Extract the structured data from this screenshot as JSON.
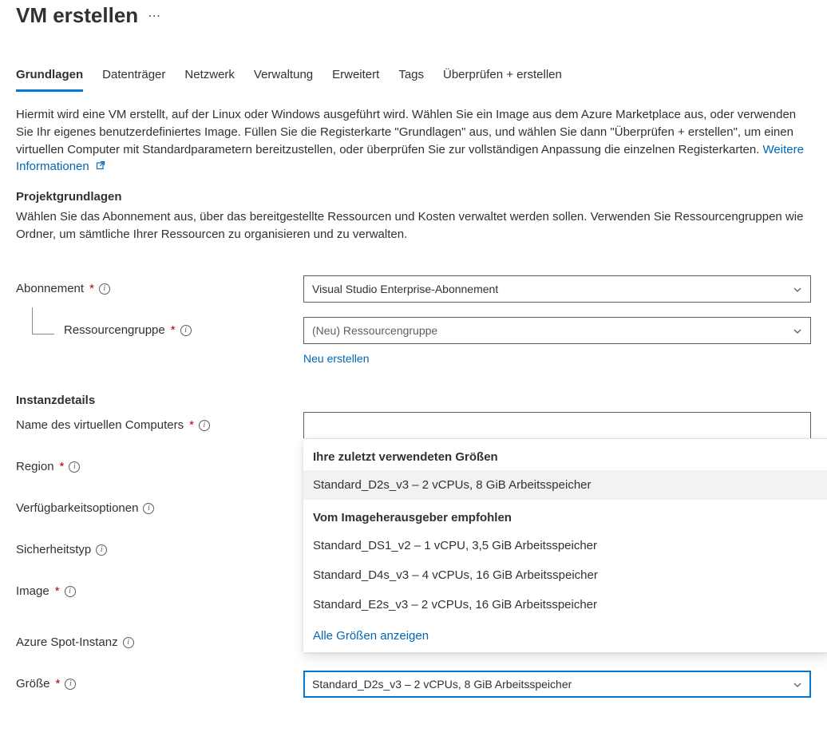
{
  "header": {
    "title": "VM erstellen"
  },
  "tabs": {
    "items": [
      {
        "label": "Grundlagen",
        "active": true
      },
      {
        "label": "Datenträger",
        "active": false
      },
      {
        "label": "Netzwerk",
        "active": false
      },
      {
        "label": "Verwaltung",
        "active": false
      },
      {
        "label": "Erweitert",
        "active": false
      },
      {
        "label": "Tags",
        "active": false
      },
      {
        "label": "Überprüfen + erstellen",
        "active": false
      }
    ]
  },
  "intro": {
    "text": "Hiermit wird eine VM erstellt, auf der Linux oder Windows ausgeführt wird. Wählen Sie ein Image aus dem Azure Marketplace aus, oder verwenden Sie Ihr eigenes benutzerdefiniertes Image. Füllen Sie die Registerkarte \"Grundlagen\" aus, und wählen Sie dann \"Überprüfen + erstellen\", um einen virtuellen Computer mit Standardparametern bereitzustellen, oder überprüfen Sie zur vollständigen Anpassung die einzelnen Registerkarten. ",
    "more_link": "Weitere Informationen"
  },
  "sections": {
    "project": {
      "heading": "Projektgrundlagen",
      "desc": "Wählen Sie das Abonnement aus, über das bereitgestellte Ressourcen und Kosten verwaltet werden sollen. Verwenden Sie Ressourcengruppen wie Ordner, um sämtliche Ihrer Ressourcen zu organisieren und zu verwalten."
    },
    "instance": {
      "heading": "Instanzdetails"
    }
  },
  "fields": {
    "subscription": {
      "label": "Abonnement",
      "value": "Visual Studio Enterprise-Abonnement"
    },
    "resource_group": {
      "label": "Ressourcengruppe",
      "value": "(Neu) Ressourcengruppe",
      "create_link": "Neu erstellen"
    },
    "vm_name": {
      "label": "Name des virtuellen Computers",
      "value": ""
    },
    "region": {
      "label": "Region"
    },
    "availability": {
      "label": "Verfügbarkeitsoptionen"
    },
    "security": {
      "label": "Sicherheitstyp"
    },
    "image": {
      "label": "Image"
    },
    "spot": {
      "label": "Azure Spot-Instanz"
    },
    "size": {
      "label": "Größe",
      "value": "Standard_D2s_v3 – 2 vCPUs, 8 GiB Arbeitsspeicher"
    }
  },
  "size_popup": {
    "group1_header": "Ihre zuletzt verwendeten Größen",
    "group1_items": [
      "Standard_D2s_v3 – 2 vCPUs, 8 GiB Arbeitsspeicher"
    ],
    "group2_header": "Vom Imageherausgeber empfohlen",
    "group2_items": [
      "Standard_DS1_v2 – 1 vCPU, 3,5 GiB Arbeitsspeicher",
      "Standard_D4s_v3 – 4 vCPUs, 16 GiB Arbeitsspeicher",
      "Standard_E2s_v3 – 2 vCPUs, 16 GiB Arbeitsspeicher"
    ],
    "all_link": "Alle Größen anzeigen"
  }
}
